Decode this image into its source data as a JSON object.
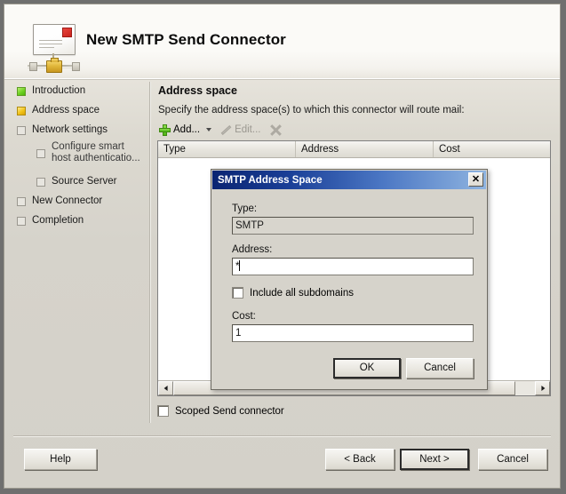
{
  "window": {
    "title": "New SMTP Send Connector",
    "icon": "smtp-connector-icon"
  },
  "sidebar": {
    "items": [
      {
        "label": "Introduction",
        "state": "done"
      },
      {
        "label": "Address space",
        "state": "current"
      },
      {
        "label": "Network settings",
        "state": "pending"
      },
      {
        "label": "Configure smart host authenticatio...",
        "state": "pending",
        "sub": true
      },
      {
        "label": "Source Server",
        "state": "pending",
        "sub": true
      },
      {
        "label": "New Connector",
        "state": "pending"
      },
      {
        "label": "Completion",
        "state": "pending"
      }
    ]
  },
  "pane": {
    "title": "Address space",
    "description": "Specify the address space(s) to which this connector will route mail:",
    "toolbar": {
      "add_label": "Add...",
      "edit_label": "Edit...",
      "remove_icon": "delete-x-icon",
      "add_dropdown_icon": "chevron-down-icon"
    },
    "listview": {
      "columns": [
        "Type",
        "Address",
        "Cost"
      ],
      "rows": []
    },
    "scoped_checkbox": {
      "label": "Scoped Send connector",
      "checked": false
    }
  },
  "footer": {
    "help_label": "Help",
    "back_label": "< Back",
    "next_label": "Next >",
    "cancel_label": "Cancel"
  },
  "dialog": {
    "title": "SMTP Address Space",
    "close_icon": "close-x-icon",
    "type_label": "Type:",
    "type_value": "SMTP",
    "address_label": "Address:",
    "address_value": "*",
    "include_subdomains_label": "Include all subdomains",
    "include_subdomains_checked": false,
    "cost_label": "Cost:",
    "cost_value": "1",
    "ok_label": "OK",
    "cancel_label": "Cancel"
  },
  "colors": {
    "window_bg": "#d6d3cb",
    "titlebar_start": "#0a2472",
    "titlebar_end": "#8fb4e0",
    "status_done": "#4eb40c",
    "status_current": "#f2c419"
  }
}
